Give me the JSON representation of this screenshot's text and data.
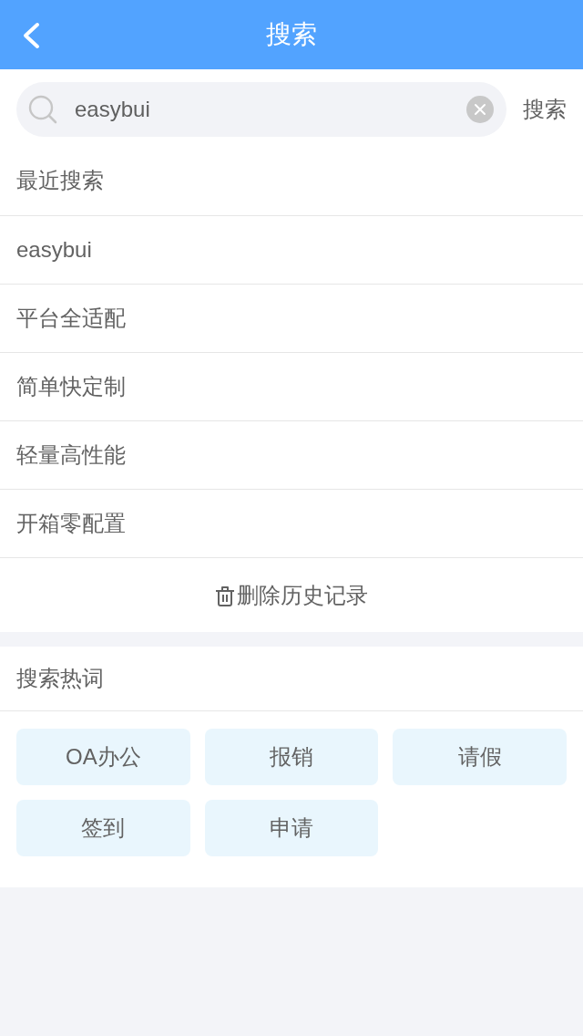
{
  "header": {
    "title": "搜索"
  },
  "search": {
    "value": "easybui",
    "button": "搜索"
  },
  "recent": {
    "title": "最近搜索",
    "items": [
      "easybui",
      "平台全适配",
      "简单快定制",
      "轻量高性能",
      "开箱零配置"
    ],
    "clear": "删除历史记录"
  },
  "hot": {
    "title": "搜索热词",
    "tags": [
      "OA办公",
      "报销",
      "请假",
      "签到",
      "申请"
    ]
  }
}
